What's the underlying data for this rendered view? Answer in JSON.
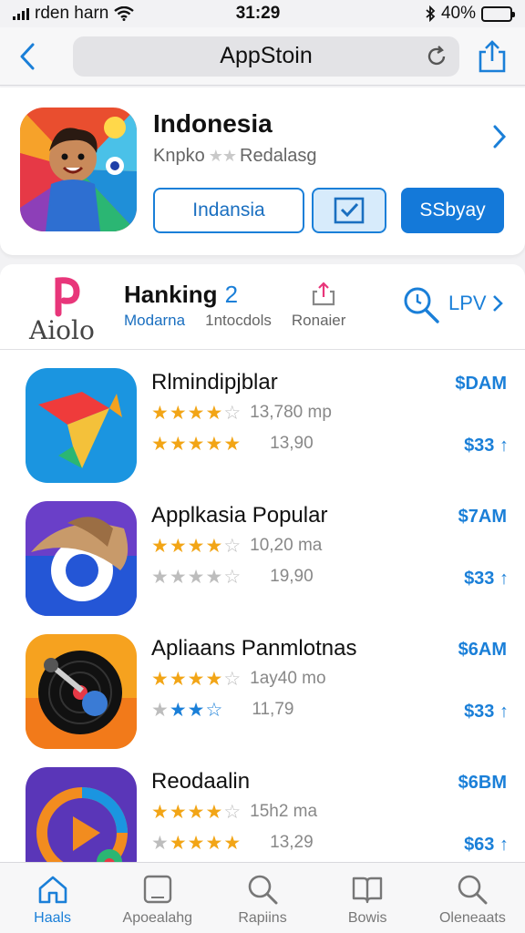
{
  "status": {
    "carrier": "rden harn",
    "time": "31:29",
    "battery": "40%",
    "battery_level": 0.4
  },
  "nav": {
    "title": "AppStoin"
  },
  "featured": {
    "title": "Indonesia",
    "subtitle_left": "Knpko",
    "subtitle_right": "Redalasg",
    "btn_outline": "Indansia",
    "btn_primary": "SSbyay"
  },
  "ranking": {
    "logo_text": "Aiolo",
    "title": "Hanking",
    "count": "2",
    "tabs": [
      "Modarna",
      "1ntocdols",
      "Ronaier"
    ],
    "lpv": "LPV"
  },
  "apps": [
    {
      "name": "Rlmindipjblar",
      "price": "$DAM",
      "rating_text": "13,780 mp",
      "rating2_text": "13,90",
      "price2": "$33"
    },
    {
      "name": "Applkasia Popular",
      "price": "$7AM",
      "rating_text": "10,20 ma",
      "rating2_text": "19,90",
      "price2": "$33"
    },
    {
      "name": "Apliaans Panmlotnas",
      "price": "$6AM",
      "rating_text": "1ay40 mo",
      "rating2_text": "11,79",
      "price2": "$33"
    },
    {
      "name": "Reodaalin",
      "price": "$6BM",
      "rating_text": "15h2 ma",
      "rating2_text": "13,29",
      "price2": "$63"
    }
  ],
  "tabs": [
    {
      "label": "Haals",
      "icon": "home-icon"
    },
    {
      "label": "Apoealahg",
      "icon": "apps-icon"
    },
    {
      "label": "Rapiins",
      "icon": "search-icon"
    },
    {
      "label": "Bowis",
      "icon": "book-icon"
    },
    {
      "label": "Oleneaats",
      "icon": "search-icon"
    }
  ],
  "colors": {
    "accent": "#1a7fd8",
    "star": "#f2a516"
  }
}
